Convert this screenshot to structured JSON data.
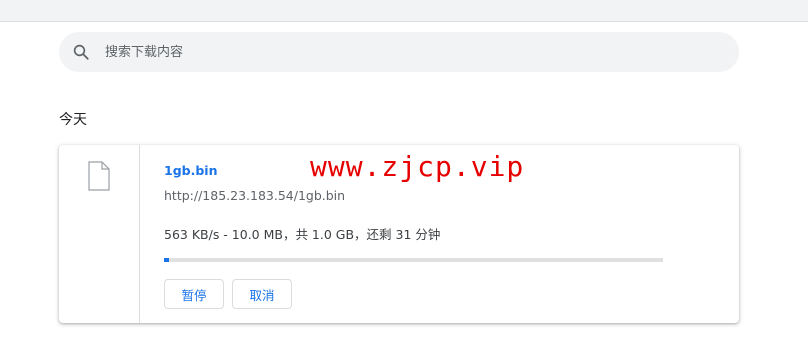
{
  "search": {
    "placeholder": "搜索下载内容",
    "icon": "search-icon"
  },
  "date_header": "今天",
  "download": {
    "file_name": "1gb.bin",
    "url": "http://185.23.183.54/1gb.bin",
    "status": "563 KB/s - 10.0 MB，共 1.0 GB，还剩 31 分钟",
    "progress_fraction": 0.0098,
    "file_icon": "file-icon",
    "buttons": {
      "pause": "暂停",
      "cancel": "取消"
    }
  },
  "watermark": "www.zjcp.vip",
  "colors": {
    "link": "#1a73e8",
    "watermark": "#e60000",
    "search_bg": "#f1f3f4",
    "progress_track": "#e0e0e0"
  }
}
